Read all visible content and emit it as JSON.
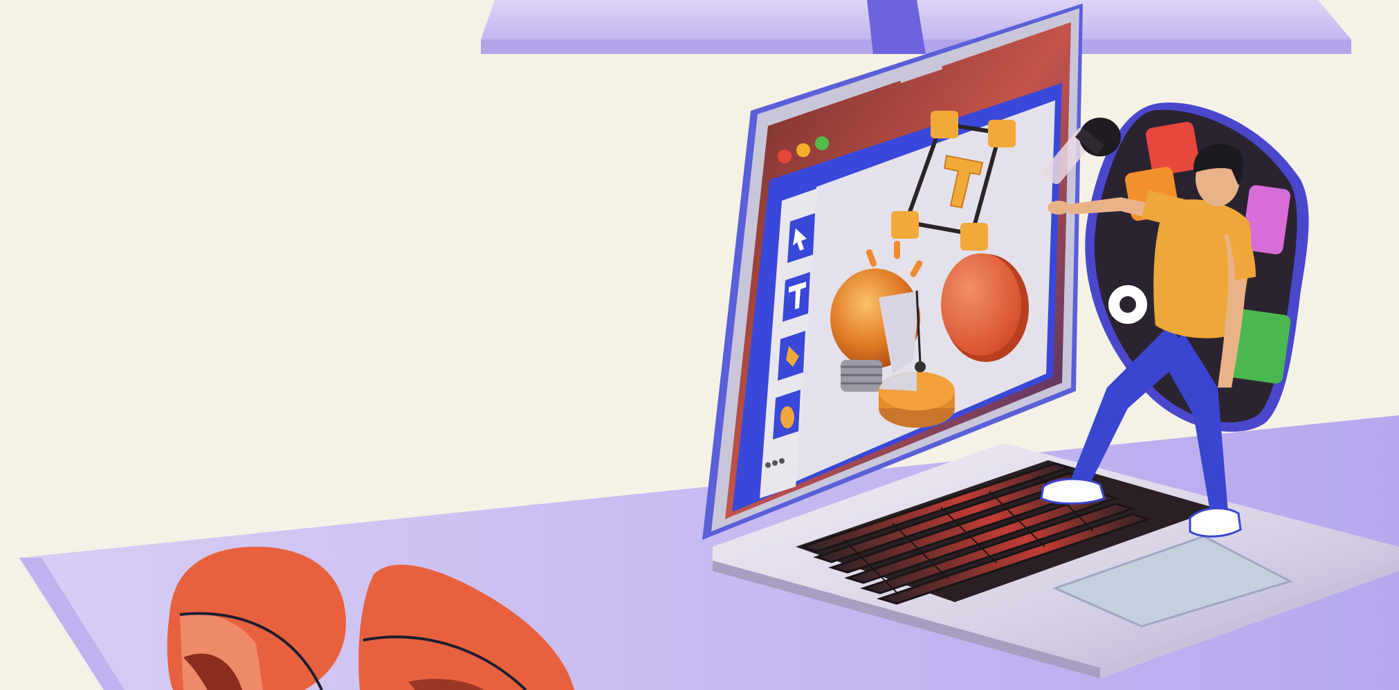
{
  "scene": {
    "background_color": "#f5f1e6",
    "shelf_color": "#cfc3f3",
    "accent_orange": "#e8613f",
    "accent_blue": "#3b4bd6",
    "shirt_color": "#f0a73a",
    "pants_color": "#3a46d2",
    "traffic_lights": [
      "#e5473a",
      "#f3b02c",
      "#4fbf4a"
    ],
    "palette_colors": [
      "#e8473e",
      "#f3902c",
      "#d76ed8",
      "#4bb84f"
    ]
  },
  "toolbar": {
    "tools": [
      {
        "name": "pointer-tool",
        "icon": "cursor-arrow-icon"
      },
      {
        "name": "text-tool",
        "icon": "letter-t-icon"
      },
      {
        "name": "pen-tool",
        "icon": "pen-nib-icon"
      },
      {
        "name": "hand-tool",
        "icon": "hand-icon"
      },
      {
        "name": "more-tool",
        "icon": "three-dots-icon"
      }
    ]
  },
  "canvas": {
    "objects": [
      "text-frame-icon",
      "lightbulb-icon",
      "circle-shape",
      "pie-chart-shape"
    ]
  }
}
